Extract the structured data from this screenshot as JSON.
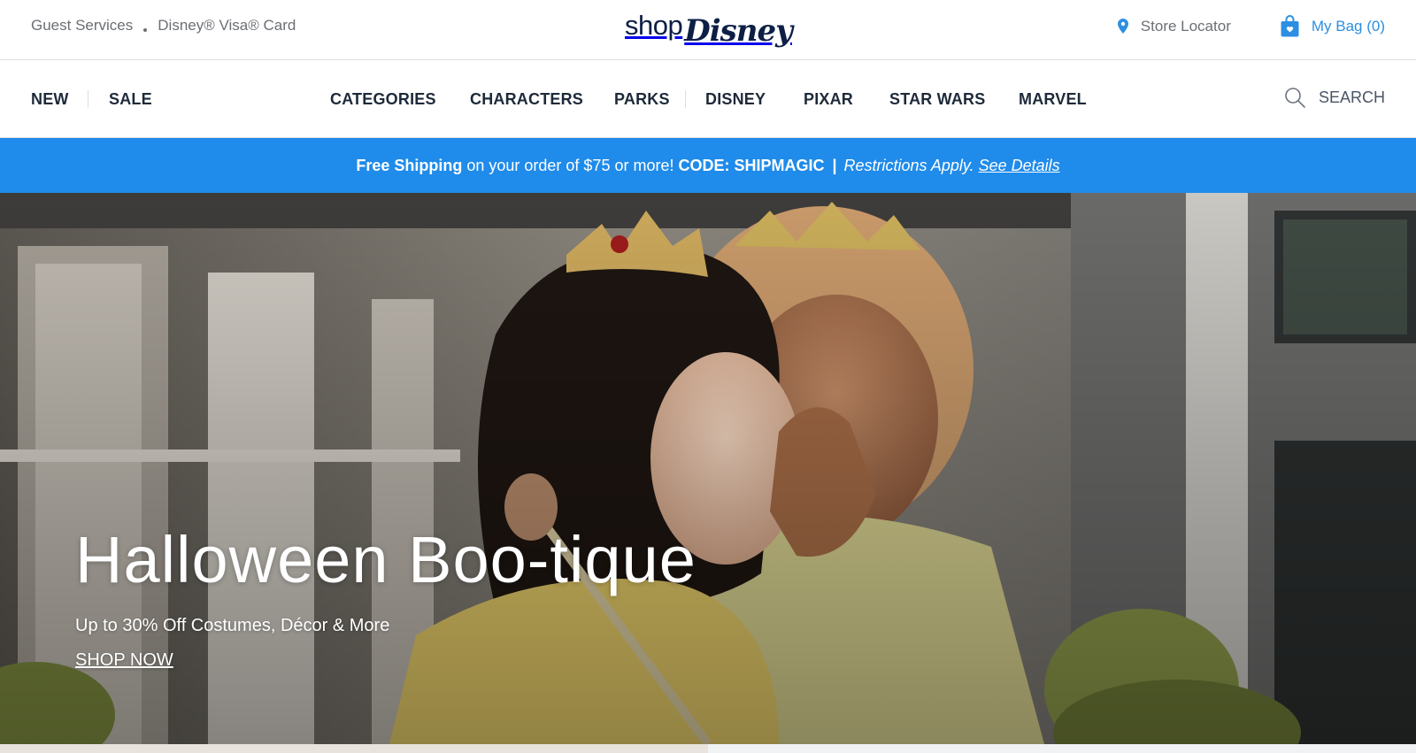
{
  "utility": {
    "guest_services": "Guest Services",
    "visa_card": "Disney® Visa® Card",
    "store_locator": "Store Locator",
    "bag": "My Bag (0)"
  },
  "logo": {
    "shop": "shop",
    "disney": "Disney"
  },
  "nav": {
    "new": "NEW",
    "sale": "SALE",
    "categories": "CATEGORIES",
    "characters": "CHARACTERS",
    "parks": "PARKS",
    "disney": "DISNEY",
    "pixar": "PIXAR",
    "star_wars": "STAR WARS",
    "marvel": "MARVEL",
    "search": "SEARCH"
  },
  "promo": {
    "free_shipping": "Free Shipping",
    "middle": "on your order of $75 or more!",
    "code": "CODE: SHIPMAGIC",
    "pipe": "|",
    "restrictions": "Restrictions Apply.",
    "details_link": "See Details"
  },
  "hero": {
    "title": "Halloween Boo-tique",
    "subtitle": "Up to 30% Off Costumes, Décor & More",
    "cta": "SHOP NOW"
  },
  "colors": {
    "accent_blue": "#1f8bea",
    "link_blue": "#2d8fe2",
    "nav_text": "#1e2a3a",
    "utility_text": "#6b6f75"
  },
  "icons": {
    "store_locator": "map-pin-icon",
    "bag": "shopping-bag-icon",
    "search": "magnifier-icon"
  }
}
